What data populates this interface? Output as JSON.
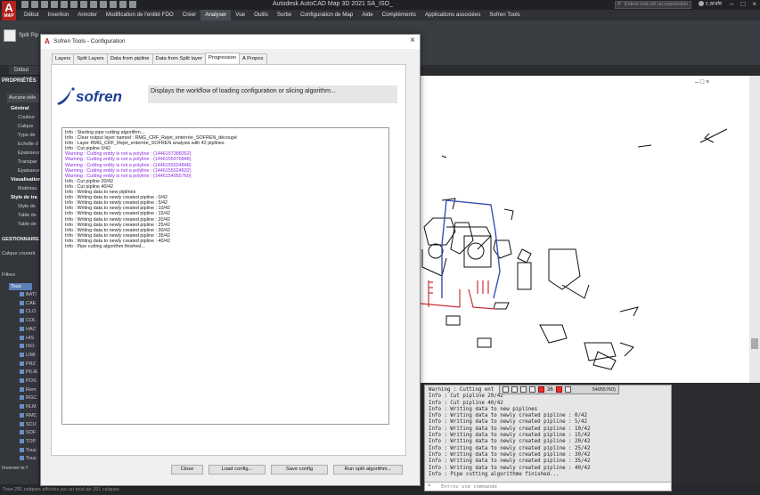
{
  "app": {
    "title": "Autodesk AutoCAD Map 3D 2021   SA_ISO_",
    "logo_letter": "A",
    "logo_sub": "MAP",
    "search_placeholder": "Entrez mot-clé ou expression",
    "user": "c.arafe",
    "menu": [
      "Début",
      "Insertion",
      "Annoter",
      "Modification de l'entité FDO",
      "Créer",
      "Analyser",
      "Vue",
      "Outils",
      "Sortie",
      "Configuration de Map",
      "Aide",
      "Compléments",
      "Applications associées",
      "Sofren Tools"
    ],
    "active_menu": "Analyser",
    "ribbon_button": "Split Pip",
    "doc_tab": "Début"
  },
  "palette": {
    "title": "PROPRIÉTÉS",
    "selection": "Aucune séle",
    "sections": [
      {
        "head": "Général",
        "rows": [
          "Couleur",
          "Calque",
          "Type de",
          "Echelle d",
          "Epaisseur",
          "Transpar",
          "Epaisseur"
        ]
      },
      {
        "head": "Visualisation",
        "rows": [
          "Matériau"
        ]
      },
      {
        "head": "Style de tra",
        "rows": [
          "Style de",
          "Table de",
          "Table de"
        ]
      }
    ],
    "manager_title": "GESTIONNAIRE",
    "current_layer": "Calque courant",
    "filters_label": "Filtres",
    "all_label": "Tous",
    "layers": [
      "BATI",
      "CAE",
      "CLO",
      "COL",
      "HAC",
      "HIS",
      "ISO",
      "LIMI",
      "PRZ",
      "PILIE",
      "POS",
      "Rem",
      "RGC",
      "RLM",
      "RMC",
      "SCU",
      "SOF",
      "TOP",
      "Tous",
      "Tous"
    ],
    "invert_label": "Inverser le f",
    "status_text": "Tous 291 calques affichés sur un total de 291 calques"
  },
  "dialog": {
    "title": "Sofren Tools - Configuration",
    "icon": "A",
    "tabs": [
      "Layers",
      "Split Layers",
      "Data from pipline",
      "Data from Split layer",
      "Progression",
      "A Propos"
    ],
    "active_tab": "Progression",
    "logo_text": "sofren",
    "description": "Displays the workflow of loading configuration or slicing algorithm...",
    "log": [
      {
        "text": "Info : Starting pipe cutting algorithm...",
        "type": "info"
      },
      {
        "text": "Info : Clear output layer named : RMG_CRF_Rejet_enterrée_SOFREN_découpé",
        "type": "info"
      },
      {
        "text": "Info : Layer RMG_CRF_Rejet_enterrée_SOFREN analysis with 42 piplines",
        "type": "info"
      },
      {
        "text": "Info : Cut pipline 0/42",
        "type": "info"
      },
      {
        "text": "Warning : Cutting entity is not a polyline : (1446157388352)",
        "type": "warn"
      },
      {
        "text": "Warning : Cutting entity is not a polyline : (1446155976848)",
        "type": "warn"
      },
      {
        "text": "Warning : Cutting entity is not a polyline : (1446155024848)",
        "type": "warn"
      },
      {
        "text": "Warning : Cutting entity is not a polyline : (1446155024832)",
        "type": "warn"
      },
      {
        "text": "Warning : Cutting entity is not a polyline : (1446154955760)",
        "type": "warn"
      },
      {
        "text": "Info : Cut pipline 20/42",
        "type": "info"
      },
      {
        "text": "Info : Cut pipline 40/42",
        "type": "info"
      },
      {
        "text": "Info : Writing data to new piplines",
        "type": "info"
      },
      {
        "text": "Info : Writing data to newly created pipline : 0/42",
        "type": "info"
      },
      {
        "text": "Info : Writing data to newly created pipline : 5/42",
        "type": "info"
      },
      {
        "text": "Info : Writing data to newly created pipline : 10/42",
        "type": "info"
      },
      {
        "text": "Info : Writing data to newly created pipline : 15/42",
        "type": "info"
      },
      {
        "text": "Info : Writing data to newly created pipline : 20/42",
        "type": "info"
      },
      {
        "text": "Info : Writing data to newly created pipline : 25/42",
        "type": "info"
      },
      {
        "text": "Info : Writing data to newly created pipline : 30/42",
        "type": "info"
      },
      {
        "text": "Info : Writing data to newly created pipline : 35/42",
        "type": "info"
      },
      {
        "text": "Info : Writing data to newly created pipline : 40/42",
        "type": "info"
      },
      {
        "text": "Info : Pipe cutting algorithm finished...",
        "type": "info"
      }
    ],
    "buttons": [
      "Close",
      "Load config...",
      "Save config",
      "Run split algorithm..."
    ]
  },
  "command": {
    "lines": [
      "Warning : Cutting ent",
      "Info : Cut pipline 20/42",
      "Info : Cut pipline 40/42",
      "Info : Writing data to new piplines",
      "Info : Writing data to newly created pipline : 0/42",
      "Info : Writing data to newly created pipline : 5/42",
      "Info : Writing data to newly created pipline : 10/42",
      "Info : Writing data to newly created pipline : 15/42",
      "Info : Writing data to newly created pipline : 20/42",
      "Info : Writing data to newly created pipline : 25/42",
      "Info : Writing data to newly created pipline : 30/42",
      "Info : Writing data to newly created pipline : 35/42",
      "Info : Writing data to newly created pipline : 40/42",
      "Info : Pipe cutting algorithme finished..."
    ],
    "placeholder": "Entrez une commande",
    "toolbar_number": "36",
    "toolbar_right": "54955760)"
  },
  "qat_count": 12,
  "colors": {
    "accent": "#b2221d",
    "warn": "#8a2be2",
    "logo_blue": "#1d3f94"
  }
}
